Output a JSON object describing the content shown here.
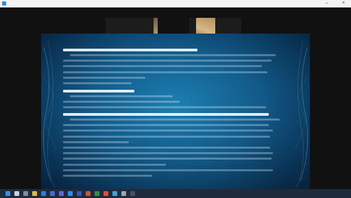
{
  "window": {
    "title": "",
    "minimize_label": "–",
    "close_label": "×"
  },
  "participants": [
    {
      "name": "",
      "subtitle": ""
    },
    {
      "name": "",
      "subtitle": ""
    }
  ],
  "slide": {
    "sections": [
      {
        "heading": "",
        "lines": [
          "",
          "",
          "",
          "",
          "",
          ""
        ]
      },
      {
        "heading": "",
        "lines": [
          "",
          "",
          ""
        ]
      },
      {
        "heading": "",
        "lines": [
          "",
          "",
          "",
          "",
          "",
          "",
          "",
          "",
          "",
          "",
          ""
        ]
      }
    ]
  },
  "side_label": "",
  "taskbar": {
    "icons": [
      "windows-start-icon",
      "search-icon",
      "task-view-icon",
      "file-explorer-icon",
      "browser-icon",
      "mail-icon",
      "store-icon",
      "video-call-icon",
      "word-icon",
      "powerpoint-icon",
      "excel-icon",
      "chrome-icon",
      "telegram-icon",
      "settings-icon",
      "camera-icon"
    ],
    "tray_text": "",
    "clock": ""
  },
  "colors": {
    "slide_center": "#1d7fb2",
    "slide_edge": "#071f36",
    "taskbar": "#1f2a3a",
    "accent": "#2d8cff"
  }
}
